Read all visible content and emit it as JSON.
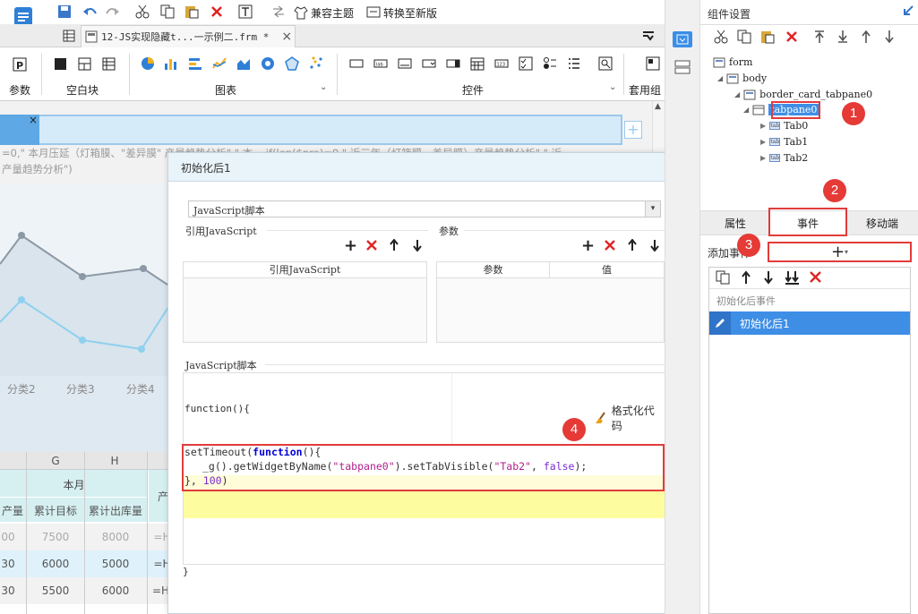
{
  "toolbar": {
    "compat_theme": "兼容主题",
    "convert_new": "转换至新版"
  },
  "file_tab": {
    "title": "12-JS实现隐藏t...一示例二.frm *"
  },
  "ribbon": {
    "param": "参数",
    "blank": "空白块",
    "chart": "图表",
    "control": "控件",
    "suite": "套用组"
  },
  "canvas": {
    "formula_line1": "=0,\" 本月压延（灯箱膜、\"差异膜\" 产量趋势分析\" \" 本... if(len($pro)=0,\" 近三年（灯箱膜、差异膜）产量趋势分析\" \" 近",
    "formula_line2": "产量趋势分析\")",
    "categories": [
      "分类2",
      "分类3",
      "分类4"
    ]
  },
  "sheet": {
    "col_g": "G",
    "col_h": "H",
    "header_month": "本月",
    "sub": [
      "产量",
      "累计目标",
      "累计出库量"
    ],
    "right_header": "产",
    "rows": [
      [
        "00",
        "7500",
        "8000",
        "=H"
      ],
      [
        "30",
        "6000",
        "5000",
        "=H"
      ],
      [
        "30",
        "5500",
        "6000",
        "=H5/F5"
      ]
    ]
  },
  "dialog": {
    "title": "初始化后1",
    "script_type": "JavaScript脚本",
    "ref_js_title": "引用JavaScript",
    "param_title": "参数",
    "ref_js_col": "引用JavaScript",
    "param_col": "参数",
    "value_col": "值",
    "js_script_title": "JavaScript脚本",
    "fn_open": "function(){",
    "format_code": "格式化代码",
    "code_line1_pre": "setTimeout(",
    "code_line1_kw": "function",
    "code_line1_post": "(){",
    "code_line2_a": "_g().getWidgetByName(",
    "code_line2_s1": "\"tabpane0\"",
    "code_line2_b": ").setTabVisible(",
    "code_line2_s2": "\"Tab2\"",
    "code_line2_c": ", ",
    "code_line2_f": "false",
    "code_line2_d": ");",
    "code_line3_a": "}, ",
    "code_line3_n": "100",
    "code_line3_b": ")",
    "fn_close": "}"
  },
  "panel": {
    "title": "组件设置",
    "tree": {
      "form": "form",
      "body": "body",
      "border": "border_card_tabpane0",
      "tabpane": "tabpane0",
      "tab0": "Tab0",
      "tab1": "Tab1",
      "tab2": "Tab2"
    },
    "tabs": {
      "props": "属性",
      "events": "事件",
      "mobile": "移动端"
    },
    "add_event": "添加事件",
    "event_group": "初始化后事件",
    "event_item": "初始化后1"
  },
  "badges": [
    "1",
    "2",
    "3",
    "4"
  ],
  "colors": {
    "accent": "#e23b3b",
    "selected": "#3e8ee6",
    "tab_blue": "#cce4f7"
  }
}
